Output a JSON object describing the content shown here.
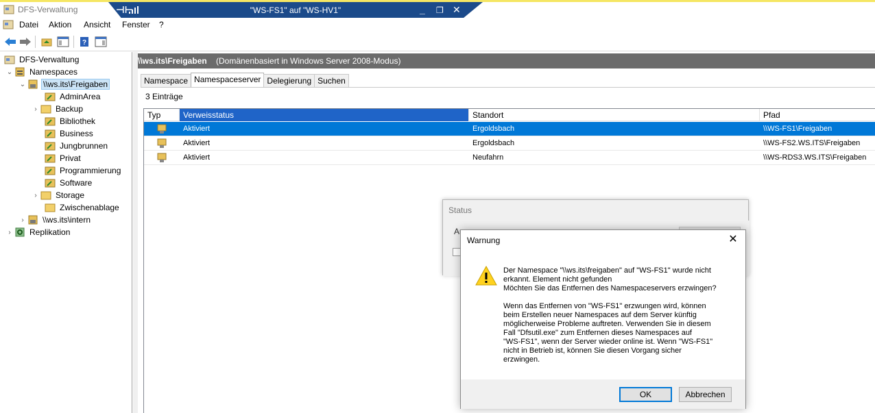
{
  "app": {
    "title": "DFS-Verwaltung"
  },
  "remote_bar": {
    "title": "\"WS-FS1\" auf \"WS-HV1\"",
    "pin": "⊣⊢",
    "minimize": "_",
    "restore": "❐",
    "close": "✕"
  },
  "menu": [
    "Datei",
    "Aktion",
    "Ansicht",
    "Fenster",
    "?"
  ],
  "tree": {
    "root": "DFS-Verwaltung",
    "namespaces": "Namespaces",
    "selected_ns": "\\\\ws.its\\Freigaben",
    "folders": [
      "AdminArea",
      "Backup",
      "Bibliothek",
      "Business",
      "Jungbrunnen",
      "Privat",
      "Programmierung",
      "Software",
      "Storage",
      "Zwischenablage"
    ],
    "other_ns": "\\\\ws.its\\intern",
    "replication": "Replikation"
  },
  "content": {
    "path": "\\\\ws.its\\Freigaben",
    "mode": "(Domänenbasiert in Windows Server 2008-Modus)",
    "tabs": [
      "Namespace",
      "Namespaceserver",
      "Delegierung",
      "Suchen"
    ],
    "active_tab": "Namespaceserver",
    "count": "3 Einträge",
    "columns": [
      "Typ",
      "Verweisstatus",
      "Standort",
      "Pfad"
    ],
    "rows": [
      {
        "status": "Aktiviert",
        "location": "Ergoldsbach",
        "path": "\\\\WS-FS1\\Freigaben"
      },
      {
        "status": "Aktiviert",
        "location": "Ergoldsbach",
        "path": "\\\\WS-FS2.WS.ITS\\Freigaben"
      },
      {
        "status": "Aktiviert",
        "location": "Neufahrn",
        "path": "\\\\WS-RDS3.WS.ITS\\Freigaben"
      }
    ]
  },
  "status_dialog": {
    "title": "Status",
    "text": "Au"
  },
  "warning": {
    "title": "Warnung",
    "line1": "Der Namespace \"\\\\ws.its\\freigaben\" auf \"WS-FS1\" wurde nicht",
    "line2": "erkannt. Element nicht gefunden",
    "line3": "Möchten Sie das Entfernen des Namespaceservers erzwingen?",
    "para2_1": "Wenn das Entfernen von \"WS-FS1\" erzwungen wird, können",
    "para2_2": "beim Erstellen neuer Namespaces auf dem Server künftig",
    "para2_3": "möglicherweise Probleme auftreten. Verwenden Sie in diesem",
    "para2_4": "Fall \"Dfsutil.exe\" zum Entfernen dieses Namespaces auf",
    "para2_5": "\"WS-FS1\", wenn der Server wieder online ist. Wenn \"WS-FS1\"",
    "para2_6": "nicht in Betrieb ist, können Sie diesen Vorgang sicher",
    "para2_7": "erzwingen.",
    "ok": "OK",
    "cancel": "Abbrechen"
  },
  "colors": {
    "selection": "#0078d7",
    "header_gray": "#6b6b6b",
    "rdp_blue": "#1b4a8a"
  }
}
